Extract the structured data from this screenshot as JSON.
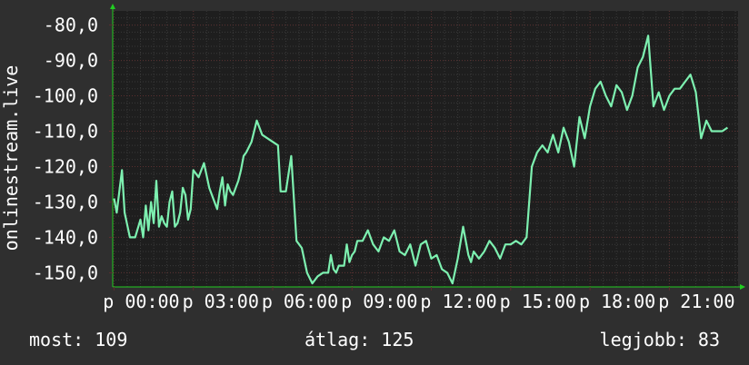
{
  "colors": {
    "background": "#2f2f2f",
    "plot_background": "#1e1e1e",
    "line": "#7df0b0",
    "grid_minor": "#3a3a3a",
    "grid_major": "#5a2f2f",
    "axis_arrow": "#22cc22",
    "text": "#ffffff"
  },
  "stats": {
    "now": "most: 109",
    "avg": "átlag: 125",
    "best": "legjobb: 83"
  },
  "chart_data": {
    "type": "line",
    "ylabel": "onlinestream.live",
    "ylim": [
      -154,
      -76
    ],
    "y_ticks": [
      -80,
      -90,
      -100,
      -110,
      -120,
      -130,
      -140,
      -150
    ],
    "y_tick_labels": [
      "-80,0",
      "-90,0",
      "-100,0",
      "-110,0",
      "-120,0",
      "-130,0",
      "-140,0",
      "-150,0"
    ],
    "x_range_hours": [
      -0.05,
      23.6
    ],
    "x_ticks": [
      0,
      3,
      6,
      9,
      12,
      15,
      18,
      21
    ],
    "x_tick_labels": [
      "p 00:00",
      "p 03:00",
      "p 06:00",
      "p 09:00",
      "p 12:00",
      "p 15:00",
      "p 18:00",
      "p 21:00"
    ],
    "grid": true,
    "series": [
      {
        "x": [
          0.0,
          0.1,
          0.2,
          0.3,
          0.4,
          0.6,
          0.8,
          1.0,
          1.1,
          1.2,
          1.3,
          1.4,
          1.5,
          1.6,
          1.7,
          1.8,
          1.9,
          2.0,
          2.1,
          2.2,
          2.3,
          2.4,
          2.5,
          2.6,
          2.7,
          2.8,
          2.9,
          3.0,
          3.2,
          3.4,
          3.6,
          3.8,
          3.9,
          4.0,
          4.1,
          4.2,
          4.3,
          4.4,
          4.5,
          4.6,
          4.7,
          4.8,
          4.9,
          5.0,
          5.2,
          5.4,
          5.6,
          5.8,
          6.0,
          6.2,
          6.3,
          6.5,
          6.7,
          6.9,
          7.1,
          7.3,
          7.5,
          7.7,
          7.9,
          8.1,
          8.2,
          8.3,
          8.4,
          8.5,
          8.7,
          8.8,
          8.9,
          9.0,
          9.1,
          9.2,
          9.4,
          9.6,
          9.8,
          10.0,
          10.2,
          10.4,
          10.6,
          10.8,
          11.0,
          11.2,
          11.4,
          11.6,
          11.8,
          12.0,
          12.2,
          12.4,
          12.6,
          12.8,
          13.0,
          13.2,
          13.4,
          13.5,
          13.6,
          13.8,
          14.0,
          14.2,
          14.4,
          14.6,
          14.8,
          15.0,
          15.2,
          15.4,
          15.6,
          15.8,
          16.0,
          16.2,
          16.4,
          16.6,
          16.8,
          17.0,
          17.2,
          17.4,
          17.6,
          17.8,
          18.0,
          18.2,
          18.4,
          18.6,
          18.8,
          19.0,
          19.2,
          19.4,
          19.6,
          19.8,
          20.0,
          20.2,
          20.4,
          20.6,
          20.8,
          21.0,
          21.2,
          21.4,
          21.6,
          21.8,
          22.0,
          22.2,
          22.4,
          22.6,
          22.8,
          23.0,
          23.2
        ],
        "values": [
          -129,
          -133,
          -127,
          -121,
          -133,
          -140,
          -140,
          -135,
          -140,
          -131,
          -138,
          -130,
          -136,
          -124,
          -137,
          -134,
          -136,
          -137,
          -130,
          -127,
          -137,
          -136,
          -133,
          -126,
          -128,
          -135,
          -132,
          -121,
          -123,
          -119,
          -126,
          -130,
          -132,
          -127,
          -123,
          -131,
          -125,
          -127,
          -128,
          -126,
          -124,
          -121,
          -117,
          -116,
          -113,
          -107,
          -111,
          -112,
          -113,
          -114,
          -127,
          -127,
          -117,
          -141,
          -143,
          -150,
          -153,
          -151,
          -150,
          -150,
          -145,
          -149,
          -150,
          -148,
          -148,
          -142,
          -147,
          -145,
          -144,
          -141,
          -141,
          -138,
          -142,
          -144,
          -140,
          -141,
          -138,
          -144,
          -145,
          -142,
          -148,
          -142,
          -141,
          -146,
          -145,
          -149,
          -150,
          -153,
          -146,
          -137,
          -145,
          -147,
          -144,
          -146,
          -144,
          -141,
          -143,
          -146,
          -142,
          -142,
          -141,
          -142,
          -140,
          -120,
          -116,
          -114,
          -116,
          -111,
          -116,
          -109,
          -113,
          -120,
          -106,
          -112,
          -103,
          -98,
          -96,
          -100,
          -103,
          -97,
          -99,
          -104,
          -100,
          -92,
          -89,
          -83,
          -103,
          -99,
          -104,
          -100,
          -98,
          -98,
          -96,
          -94,
          -99,
          -112,
          -107,
          -110,
          -110,
          -110,
          -109
        ]
      }
    ]
  }
}
